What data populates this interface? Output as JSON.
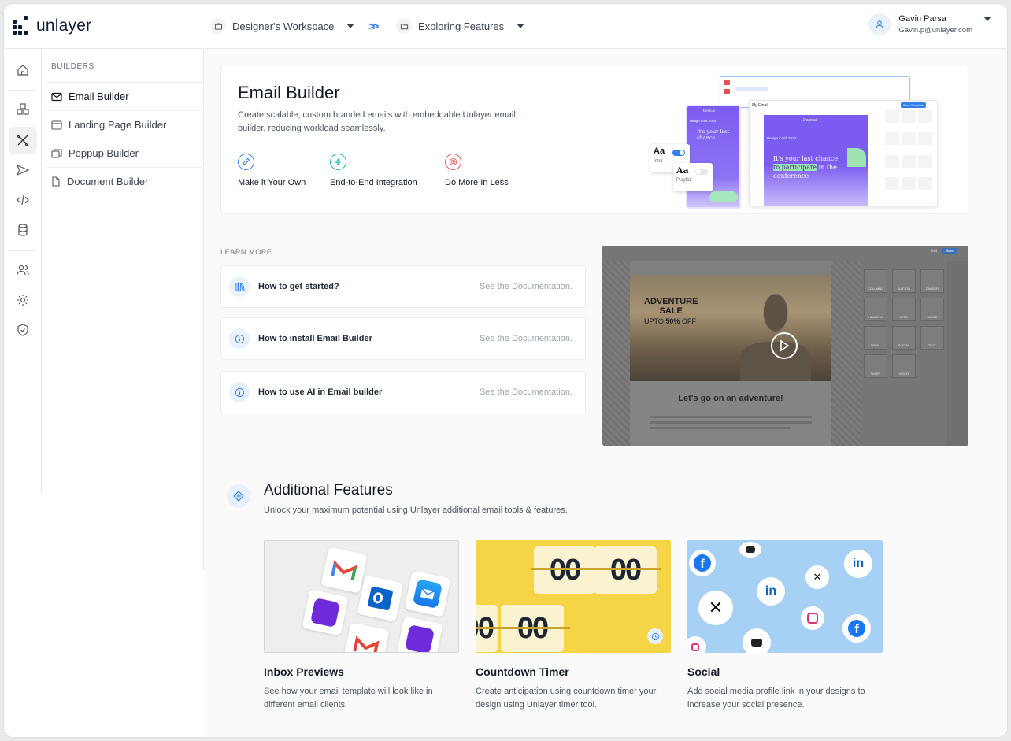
{
  "topbar": {
    "logo": "unlayer",
    "workspace": "Designer's Workspace",
    "project": "Exploring Features",
    "user_name": "Gavin Parsa",
    "user_email": "Gavin.p@unlayer.com"
  },
  "rail": {
    "icons": [
      "home-icon",
      "blocks-icon",
      "builder-tools-icon",
      "send-icon",
      "code-icon",
      "database-icon",
      "users-icon",
      "settings-icon",
      "shield-icon"
    ]
  },
  "builders": {
    "heading": "BUILDERS",
    "items": [
      {
        "label": "Email Builder"
      },
      {
        "label": "Landing Page Builder"
      },
      {
        "label": "Poppup Builder"
      },
      {
        "label": "Document Builder"
      }
    ]
  },
  "hero": {
    "title": "Email Builder",
    "description": "Create scalable, custom branded emails with embeddable Unlayer email builder, reducing workload seamlessly.",
    "features": [
      {
        "label": "Make it Your Own",
        "icon": "pen-icon",
        "color": "#2f80ed"
      },
      {
        "label": "End-to-End Integration",
        "icon": "bolt-icon",
        "color": "#14b8a6"
      },
      {
        "label": "Do More In Less",
        "icon": "target-icon",
        "color": "#ef5350"
      }
    ],
    "preview": {
      "brand": "Desn.ai",
      "conf": "Design Conf. 2024",
      "headline_1": "It's your last chance",
      "headline_2": "to participate",
      "headline_3": "in the conference",
      "font_1": "Aa",
      "font_1_name": "Inter",
      "font_2": "Aa",
      "font_2_name": "Playfair",
      "editor_label": "My Email",
      "save_label": "Save Template"
    }
  },
  "learn": {
    "heading": "LEARN MORE",
    "items": [
      {
        "title": "How to get started?",
        "link": "See the Documentation."
      },
      {
        "title": "How to install Email Builder",
        "link": "See the Documentation."
      },
      {
        "title": "How to use AI in Email builder",
        "link": "See the Documentation."
      }
    ]
  },
  "video": {
    "headline_1": "ADVENTURE",
    "headline_2": "SALE",
    "offer_1": "UPTO ",
    "offer_2": "50%",
    "offer_3": " OFF",
    "tagline": "Let's go on an adventure!",
    "tools": [
      "COLUMNS",
      "BUTTON",
      "DIVIDER",
      "HEADING",
      "HTML",
      "IMAGE",
      "MENU",
      "SOCIAL",
      "TEXT",
      "TIMER",
      "VIDEO"
    ],
    "undo": "Exit",
    "save": "Save"
  },
  "additional": {
    "title": "Additional Features",
    "subtitle": "Unlock your maximum potential using Unlayer additional email tools & features.",
    "cards": [
      {
        "title": "Inbox Previews",
        "description": "See how your email template will look like in different email clients."
      },
      {
        "title": "Countdown Timer",
        "description": "Create anticipation using countdown timer your design using Unlayer timer tool.",
        "digits": "00"
      },
      {
        "title": "Social",
        "description": "Add social media profile link in your designs to increase your social presence."
      }
    ]
  },
  "colors": {
    "accent": "#2f80ed",
    "purple": "#7c5cf0",
    "timer_yellow": "#f5d546",
    "social_blue": "#a7d0f5"
  }
}
